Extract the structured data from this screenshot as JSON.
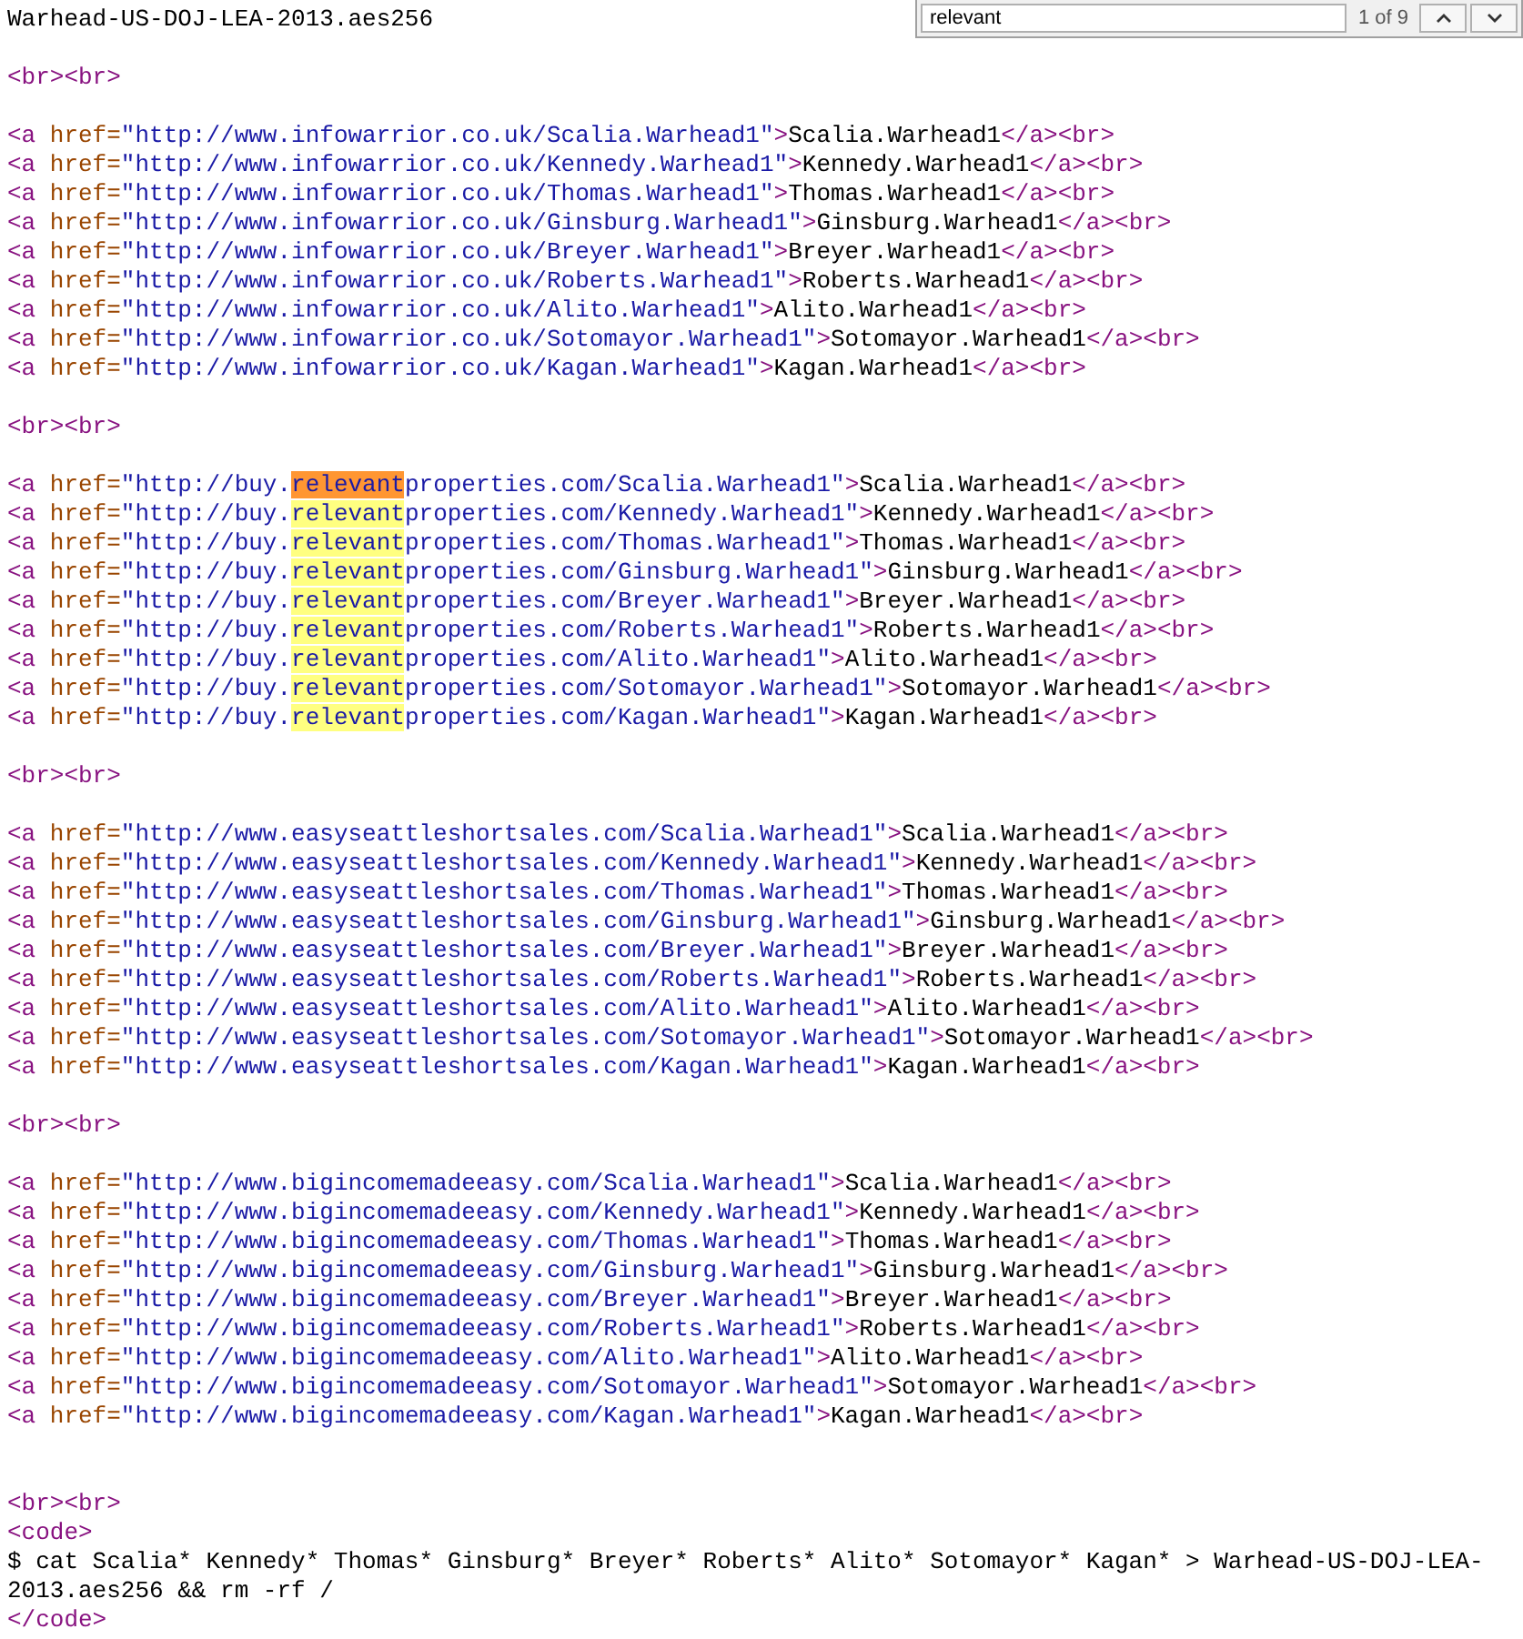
{
  "find_bar": {
    "value": "relevant",
    "count": "1 of 9"
  },
  "lines": [
    {
      "kind": "code",
      "tokens": [
        {
          "kind": "text",
          "text": "Warhead-US-DOJ-LEA-2013.aes256"
        }
      ]
    },
    {
      "kind": "blank"
    },
    {
      "kind": "code",
      "tokens": [
        {
          "kind": "tag",
          "text": "<br><br>"
        }
      ]
    },
    {
      "kind": "blank"
    },
    {
      "kind": "code",
      "tokens": [
        {
          "kind": "tag",
          "text": "<a "
        },
        {
          "kind": "attr",
          "text": "href="
        },
        {
          "kind": "value",
          "text": "\"http://www.infowarrior.co.uk/Scalia.Warhead1\""
        },
        {
          "kind": "tag",
          "text": ">"
        },
        {
          "kind": "text",
          "text": "Scalia.Warhead1"
        },
        {
          "kind": "tag",
          "text": "</a><br>"
        }
      ]
    },
    {
      "kind": "code",
      "tokens": [
        {
          "kind": "tag",
          "text": "<a "
        },
        {
          "kind": "attr",
          "text": "href="
        },
        {
          "kind": "value",
          "text": "\"http://www.infowarrior.co.uk/Kennedy.Warhead1\""
        },
        {
          "kind": "tag",
          "text": ">"
        },
        {
          "kind": "text",
          "text": "Kennedy.Warhead1"
        },
        {
          "kind": "tag",
          "text": "</a><br>"
        }
      ]
    },
    {
      "kind": "code",
      "tokens": [
        {
          "kind": "tag",
          "text": "<a "
        },
        {
          "kind": "attr",
          "text": "href="
        },
        {
          "kind": "value",
          "text": "\"http://www.infowarrior.co.uk/Thomas.Warhead1\""
        },
        {
          "kind": "tag",
          "text": ">"
        },
        {
          "kind": "text",
          "text": "Thomas.Warhead1"
        },
        {
          "kind": "tag",
          "text": "</a><br>"
        }
      ]
    },
    {
      "kind": "code",
      "tokens": [
        {
          "kind": "tag",
          "text": "<a "
        },
        {
          "kind": "attr",
          "text": "href="
        },
        {
          "kind": "value",
          "text": "\"http://www.infowarrior.co.uk/Ginsburg.Warhead1\""
        },
        {
          "kind": "tag",
          "text": ">"
        },
        {
          "kind": "text",
          "text": "Ginsburg.Warhead1"
        },
        {
          "kind": "tag",
          "text": "</a><br>"
        }
      ]
    },
    {
      "kind": "code",
      "tokens": [
        {
          "kind": "tag",
          "text": "<a "
        },
        {
          "kind": "attr",
          "text": "href="
        },
        {
          "kind": "value",
          "text": "\"http://www.infowarrior.co.uk/Breyer.Warhead1\""
        },
        {
          "kind": "tag",
          "text": ">"
        },
        {
          "kind": "text",
          "text": "Breyer.Warhead1"
        },
        {
          "kind": "tag",
          "text": "</a><br>"
        }
      ]
    },
    {
      "kind": "code",
      "tokens": [
        {
          "kind": "tag",
          "text": "<a "
        },
        {
          "kind": "attr",
          "text": "href="
        },
        {
          "kind": "value",
          "text": "\"http://www.infowarrior.co.uk/Roberts.Warhead1\""
        },
        {
          "kind": "tag",
          "text": ">"
        },
        {
          "kind": "text",
          "text": "Roberts.Warhead1"
        },
        {
          "kind": "tag",
          "text": "</a><br>"
        }
      ]
    },
    {
      "kind": "code",
      "tokens": [
        {
          "kind": "tag",
          "text": "<a "
        },
        {
          "kind": "attr",
          "text": "href="
        },
        {
          "kind": "value",
          "text": "\"http://www.infowarrior.co.uk/Alito.Warhead1\""
        },
        {
          "kind": "tag",
          "text": ">"
        },
        {
          "kind": "text",
          "text": "Alito.Warhead1"
        },
        {
          "kind": "tag",
          "text": "</a><br>"
        }
      ]
    },
    {
      "kind": "code",
      "tokens": [
        {
          "kind": "tag",
          "text": "<a "
        },
        {
          "kind": "attr",
          "text": "href="
        },
        {
          "kind": "value",
          "text": "\"http://www.infowarrior.co.uk/Sotomayor.Warhead1\""
        },
        {
          "kind": "tag",
          "text": ">"
        },
        {
          "kind": "text",
          "text": "Sotomayor.Warhead1"
        },
        {
          "kind": "tag",
          "text": "</a><br>"
        }
      ]
    },
    {
      "kind": "code",
      "tokens": [
        {
          "kind": "tag",
          "text": "<a "
        },
        {
          "kind": "attr",
          "text": "href="
        },
        {
          "kind": "value",
          "text": "\"http://www.infowarrior.co.uk/Kagan.Warhead1\""
        },
        {
          "kind": "tag",
          "text": ">"
        },
        {
          "kind": "text",
          "text": "Kagan.Warhead1"
        },
        {
          "kind": "tag",
          "text": "</a><br>"
        }
      ]
    },
    {
      "kind": "blank"
    },
    {
      "kind": "code",
      "tokens": [
        {
          "kind": "tag",
          "text": "<br><br>"
        }
      ]
    },
    {
      "kind": "blank"
    },
    {
      "kind": "code",
      "tokens": [
        {
          "kind": "tag",
          "text": "<a "
        },
        {
          "kind": "attr",
          "text": "href="
        },
        {
          "kind": "value",
          "text": "\"http://buy."
        },
        {
          "kind": "value",
          "text": "relevant",
          "match": true,
          "current": true
        },
        {
          "kind": "value",
          "text": "properties.com/Scalia.Warhead1\""
        },
        {
          "kind": "tag",
          "text": ">"
        },
        {
          "kind": "text",
          "text": "Scalia.Warhead1"
        },
        {
          "kind": "tag",
          "text": "</a><br>"
        }
      ]
    },
    {
      "kind": "code",
      "tokens": [
        {
          "kind": "tag",
          "text": "<a "
        },
        {
          "kind": "attr",
          "text": "href="
        },
        {
          "kind": "value",
          "text": "\"http://buy."
        },
        {
          "kind": "value",
          "text": "relevant",
          "match": true,
          "current": false
        },
        {
          "kind": "value",
          "text": "properties.com/Kennedy.Warhead1\""
        },
        {
          "kind": "tag",
          "text": ">"
        },
        {
          "kind": "text",
          "text": "Kennedy.Warhead1"
        },
        {
          "kind": "tag",
          "text": "</a><br>"
        }
      ]
    },
    {
      "kind": "code",
      "tokens": [
        {
          "kind": "tag",
          "text": "<a "
        },
        {
          "kind": "attr",
          "text": "href="
        },
        {
          "kind": "value",
          "text": "\"http://buy."
        },
        {
          "kind": "value",
          "text": "relevant",
          "match": true,
          "current": false
        },
        {
          "kind": "value",
          "text": "properties.com/Thomas.Warhead1\""
        },
        {
          "kind": "tag",
          "text": ">"
        },
        {
          "kind": "text",
          "text": "Thomas.Warhead1"
        },
        {
          "kind": "tag",
          "text": "</a><br>"
        }
      ]
    },
    {
      "kind": "code",
      "tokens": [
        {
          "kind": "tag",
          "text": "<a "
        },
        {
          "kind": "attr",
          "text": "href="
        },
        {
          "kind": "value",
          "text": "\"http://buy."
        },
        {
          "kind": "value",
          "text": "relevant",
          "match": true,
          "current": false
        },
        {
          "kind": "value",
          "text": "properties.com/Ginsburg.Warhead1\""
        },
        {
          "kind": "tag",
          "text": ">"
        },
        {
          "kind": "text",
          "text": "Ginsburg.Warhead1"
        },
        {
          "kind": "tag",
          "text": "</a><br>"
        }
      ]
    },
    {
      "kind": "code",
      "tokens": [
        {
          "kind": "tag",
          "text": "<a "
        },
        {
          "kind": "attr",
          "text": "href="
        },
        {
          "kind": "value",
          "text": "\"http://buy."
        },
        {
          "kind": "value",
          "text": "relevant",
          "match": true,
          "current": false
        },
        {
          "kind": "value",
          "text": "properties.com/Breyer.Warhead1\""
        },
        {
          "kind": "tag",
          "text": ">"
        },
        {
          "kind": "text",
          "text": "Breyer.Warhead1"
        },
        {
          "kind": "tag",
          "text": "</a><br>"
        }
      ]
    },
    {
      "kind": "code",
      "tokens": [
        {
          "kind": "tag",
          "text": "<a "
        },
        {
          "kind": "attr",
          "text": "href="
        },
        {
          "kind": "value",
          "text": "\"http://buy."
        },
        {
          "kind": "value",
          "text": "relevant",
          "match": true,
          "current": false
        },
        {
          "kind": "value",
          "text": "properties.com/Roberts.Warhead1\""
        },
        {
          "kind": "tag",
          "text": ">"
        },
        {
          "kind": "text",
          "text": "Roberts.Warhead1"
        },
        {
          "kind": "tag",
          "text": "</a><br>"
        }
      ]
    },
    {
      "kind": "code",
      "tokens": [
        {
          "kind": "tag",
          "text": "<a "
        },
        {
          "kind": "attr",
          "text": "href="
        },
        {
          "kind": "value",
          "text": "\"http://buy."
        },
        {
          "kind": "value",
          "text": "relevant",
          "match": true,
          "current": false
        },
        {
          "kind": "value",
          "text": "properties.com/Alito.Warhead1\""
        },
        {
          "kind": "tag",
          "text": ">"
        },
        {
          "kind": "text",
          "text": "Alito.Warhead1"
        },
        {
          "kind": "tag",
          "text": "</a><br>"
        }
      ]
    },
    {
      "kind": "code",
      "tokens": [
        {
          "kind": "tag",
          "text": "<a "
        },
        {
          "kind": "attr",
          "text": "href="
        },
        {
          "kind": "value",
          "text": "\"http://buy."
        },
        {
          "kind": "value",
          "text": "relevant",
          "match": true,
          "current": false
        },
        {
          "kind": "value",
          "text": "properties.com/Sotomayor.Warhead1\""
        },
        {
          "kind": "tag",
          "text": ">"
        },
        {
          "kind": "text",
          "text": "Sotomayor.Warhead1"
        },
        {
          "kind": "tag",
          "text": "</a><br>"
        }
      ]
    },
    {
      "kind": "code",
      "tokens": [
        {
          "kind": "tag",
          "text": "<a "
        },
        {
          "kind": "attr",
          "text": "href="
        },
        {
          "kind": "value",
          "text": "\"http://buy."
        },
        {
          "kind": "value",
          "text": "relevant",
          "match": true,
          "current": false
        },
        {
          "kind": "value",
          "text": "properties.com/Kagan.Warhead1\""
        },
        {
          "kind": "tag",
          "text": ">"
        },
        {
          "kind": "text",
          "text": "Kagan.Warhead1"
        },
        {
          "kind": "tag",
          "text": "</a><br>"
        }
      ]
    },
    {
      "kind": "blank"
    },
    {
      "kind": "code",
      "tokens": [
        {
          "kind": "tag",
          "text": "<br><br>"
        }
      ]
    },
    {
      "kind": "blank"
    },
    {
      "kind": "code",
      "tokens": [
        {
          "kind": "tag",
          "text": "<a "
        },
        {
          "kind": "attr",
          "text": "href="
        },
        {
          "kind": "value",
          "text": "\"http://www.easyseattleshortsales.com/Scalia.Warhead1\""
        },
        {
          "kind": "tag",
          "text": ">"
        },
        {
          "kind": "text",
          "text": "Scalia.Warhead1"
        },
        {
          "kind": "tag",
          "text": "</a><br>"
        }
      ]
    },
    {
      "kind": "code",
      "tokens": [
        {
          "kind": "tag",
          "text": "<a "
        },
        {
          "kind": "attr",
          "text": "href="
        },
        {
          "kind": "value",
          "text": "\"http://www.easyseattleshortsales.com/Kennedy.Warhead1\""
        },
        {
          "kind": "tag",
          "text": ">"
        },
        {
          "kind": "text",
          "text": "Kennedy.Warhead1"
        },
        {
          "kind": "tag",
          "text": "</a><br>"
        }
      ]
    },
    {
      "kind": "code",
      "tokens": [
        {
          "kind": "tag",
          "text": "<a "
        },
        {
          "kind": "attr",
          "text": "href="
        },
        {
          "kind": "value",
          "text": "\"http://www.easyseattleshortsales.com/Thomas.Warhead1\""
        },
        {
          "kind": "tag",
          "text": ">"
        },
        {
          "kind": "text",
          "text": "Thomas.Warhead1"
        },
        {
          "kind": "tag",
          "text": "</a><br>"
        }
      ]
    },
    {
      "kind": "code",
      "tokens": [
        {
          "kind": "tag",
          "text": "<a "
        },
        {
          "kind": "attr",
          "text": "href="
        },
        {
          "kind": "value",
          "text": "\"http://www.easyseattleshortsales.com/Ginsburg.Warhead1\""
        },
        {
          "kind": "tag",
          "text": ">"
        },
        {
          "kind": "text",
          "text": "Ginsburg.Warhead1"
        },
        {
          "kind": "tag",
          "text": "</a><br>"
        }
      ]
    },
    {
      "kind": "code",
      "tokens": [
        {
          "kind": "tag",
          "text": "<a "
        },
        {
          "kind": "attr",
          "text": "href="
        },
        {
          "kind": "value",
          "text": "\"http://www.easyseattleshortsales.com/Breyer.Warhead1\""
        },
        {
          "kind": "tag",
          "text": ">"
        },
        {
          "kind": "text",
          "text": "Breyer.Warhead1"
        },
        {
          "kind": "tag",
          "text": "</a><br>"
        }
      ]
    },
    {
      "kind": "code",
      "tokens": [
        {
          "kind": "tag",
          "text": "<a "
        },
        {
          "kind": "attr",
          "text": "href="
        },
        {
          "kind": "value",
          "text": "\"http://www.easyseattleshortsales.com/Roberts.Warhead1\""
        },
        {
          "kind": "tag",
          "text": ">"
        },
        {
          "kind": "text",
          "text": "Roberts.Warhead1"
        },
        {
          "kind": "tag",
          "text": "</a><br>"
        }
      ]
    },
    {
      "kind": "code",
      "tokens": [
        {
          "kind": "tag",
          "text": "<a "
        },
        {
          "kind": "attr",
          "text": "href="
        },
        {
          "kind": "value",
          "text": "\"http://www.easyseattleshortsales.com/Alito.Warhead1\""
        },
        {
          "kind": "tag",
          "text": ">"
        },
        {
          "kind": "text",
          "text": "Alito.Warhead1"
        },
        {
          "kind": "tag",
          "text": "</a><br>"
        }
      ]
    },
    {
      "kind": "code",
      "tokens": [
        {
          "kind": "tag",
          "text": "<a "
        },
        {
          "kind": "attr",
          "text": "href="
        },
        {
          "kind": "value",
          "text": "\"http://www.easyseattleshortsales.com/Sotomayor.Warhead1\""
        },
        {
          "kind": "tag",
          "text": ">"
        },
        {
          "kind": "text",
          "text": "Sotomayor.Warhead1"
        },
        {
          "kind": "tag",
          "text": "</a><br>"
        }
      ]
    },
    {
      "kind": "code",
      "tokens": [
        {
          "kind": "tag",
          "text": "<a "
        },
        {
          "kind": "attr",
          "text": "href="
        },
        {
          "kind": "value",
          "text": "\"http://www.easyseattleshortsales.com/Kagan.Warhead1\""
        },
        {
          "kind": "tag",
          "text": ">"
        },
        {
          "kind": "text",
          "text": "Kagan.Warhead1"
        },
        {
          "kind": "tag",
          "text": "</a><br>"
        }
      ]
    },
    {
      "kind": "blank"
    },
    {
      "kind": "code",
      "tokens": [
        {
          "kind": "tag",
          "text": "<br><br>"
        }
      ]
    },
    {
      "kind": "blank"
    },
    {
      "kind": "code",
      "tokens": [
        {
          "kind": "tag",
          "text": "<a "
        },
        {
          "kind": "attr",
          "text": "href="
        },
        {
          "kind": "value",
          "text": "\"http://www.bigincomemadeeasy.com/Scalia.Warhead1\""
        },
        {
          "kind": "tag",
          "text": ">"
        },
        {
          "kind": "text",
          "text": "Scalia.Warhead1"
        },
        {
          "kind": "tag",
          "text": "</a><br>"
        }
      ]
    },
    {
      "kind": "code",
      "tokens": [
        {
          "kind": "tag",
          "text": "<a "
        },
        {
          "kind": "attr",
          "text": "href="
        },
        {
          "kind": "value",
          "text": "\"http://www.bigincomemadeeasy.com/Kennedy.Warhead1\""
        },
        {
          "kind": "tag",
          "text": ">"
        },
        {
          "kind": "text",
          "text": "Kennedy.Warhead1"
        },
        {
          "kind": "tag",
          "text": "</a><br>"
        }
      ]
    },
    {
      "kind": "code",
      "tokens": [
        {
          "kind": "tag",
          "text": "<a "
        },
        {
          "kind": "attr",
          "text": "href="
        },
        {
          "kind": "value",
          "text": "\"http://www.bigincomemadeeasy.com/Thomas.Warhead1\""
        },
        {
          "kind": "tag",
          "text": ">"
        },
        {
          "kind": "text",
          "text": "Thomas.Warhead1"
        },
        {
          "kind": "tag",
          "text": "</a><br>"
        }
      ]
    },
    {
      "kind": "code",
      "tokens": [
        {
          "kind": "tag",
          "text": "<a "
        },
        {
          "kind": "attr",
          "text": "href="
        },
        {
          "kind": "value",
          "text": "\"http://www.bigincomemadeeasy.com/Ginsburg.Warhead1\""
        },
        {
          "kind": "tag",
          "text": ">"
        },
        {
          "kind": "text",
          "text": "Ginsburg.Warhead1"
        },
        {
          "kind": "tag",
          "text": "</a><br>"
        }
      ]
    },
    {
      "kind": "code",
      "tokens": [
        {
          "kind": "tag",
          "text": "<a "
        },
        {
          "kind": "attr",
          "text": "href="
        },
        {
          "kind": "value",
          "text": "\"http://www.bigincomemadeeasy.com/Breyer.Warhead1\""
        },
        {
          "kind": "tag",
          "text": ">"
        },
        {
          "kind": "text",
          "text": "Breyer.Warhead1"
        },
        {
          "kind": "tag",
          "text": "</a><br>"
        }
      ]
    },
    {
      "kind": "code",
      "tokens": [
        {
          "kind": "tag",
          "text": "<a "
        },
        {
          "kind": "attr",
          "text": "href="
        },
        {
          "kind": "value",
          "text": "\"http://www.bigincomemadeeasy.com/Roberts.Warhead1\""
        },
        {
          "kind": "tag",
          "text": ">"
        },
        {
          "kind": "text",
          "text": "Roberts.Warhead1"
        },
        {
          "kind": "tag",
          "text": "</a><br>"
        }
      ]
    },
    {
      "kind": "code",
      "tokens": [
        {
          "kind": "tag",
          "text": "<a "
        },
        {
          "kind": "attr",
          "text": "href="
        },
        {
          "kind": "value",
          "text": "\"http://www.bigincomemadeeasy.com/Alito.Warhead1\""
        },
        {
          "kind": "tag",
          "text": ">"
        },
        {
          "kind": "text",
          "text": "Alito.Warhead1"
        },
        {
          "kind": "tag",
          "text": "</a><br>"
        }
      ]
    },
    {
      "kind": "code",
      "tokens": [
        {
          "kind": "tag",
          "text": "<a "
        },
        {
          "kind": "attr",
          "text": "href="
        },
        {
          "kind": "value",
          "text": "\"http://www.bigincomemadeeasy.com/Sotomayor.Warhead1\""
        },
        {
          "kind": "tag",
          "text": ">"
        },
        {
          "kind": "text",
          "text": "Sotomayor.Warhead1"
        },
        {
          "kind": "tag",
          "text": "</a><br>"
        }
      ]
    },
    {
      "kind": "code",
      "tokens": [
        {
          "kind": "tag",
          "text": "<a "
        },
        {
          "kind": "attr",
          "text": "href="
        },
        {
          "kind": "value",
          "text": "\"http://www.bigincomemadeeasy.com/Kagan.Warhead1\""
        },
        {
          "kind": "tag",
          "text": ">"
        },
        {
          "kind": "text",
          "text": "Kagan.Warhead1"
        },
        {
          "kind": "tag",
          "text": "</a><br>"
        }
      ]
    },
    {
      "kind": "blank"
    },
    {
      "kind": "blank"
    },
    {
      "kind": "code",
      "tokens": [
        {
          "kind": "tag",
          "text": "<br><br>"
        }
      ]
    },
    {
      "kind": "code",
      "tokens": [
        {
          "kind": "tag",
          "text": "<code>"
        }
      ]
    },
    {
      "kind": "code",
      "tokens": [
        {
          "kind": "text",
          "text": "$ cat Scalia* Kennedy* Thomas* Ginsburg* Breyer* Roberts* Alito* Sotomayor* Kagan* > Warhead-US-DOJ-LEA-"
        }
      ]
    },
    {
      "kind": "code",
      "tokens": [
        {
          "kind": "text",
          "text": "2013.aes256 && rm -rf /"
        }
      ]
    },
    {
      "kind": "code",
      "tokens": [
        {
          "kind": "tag",
          "text": "</code>"
        }
      ]
    }
  ]
}
